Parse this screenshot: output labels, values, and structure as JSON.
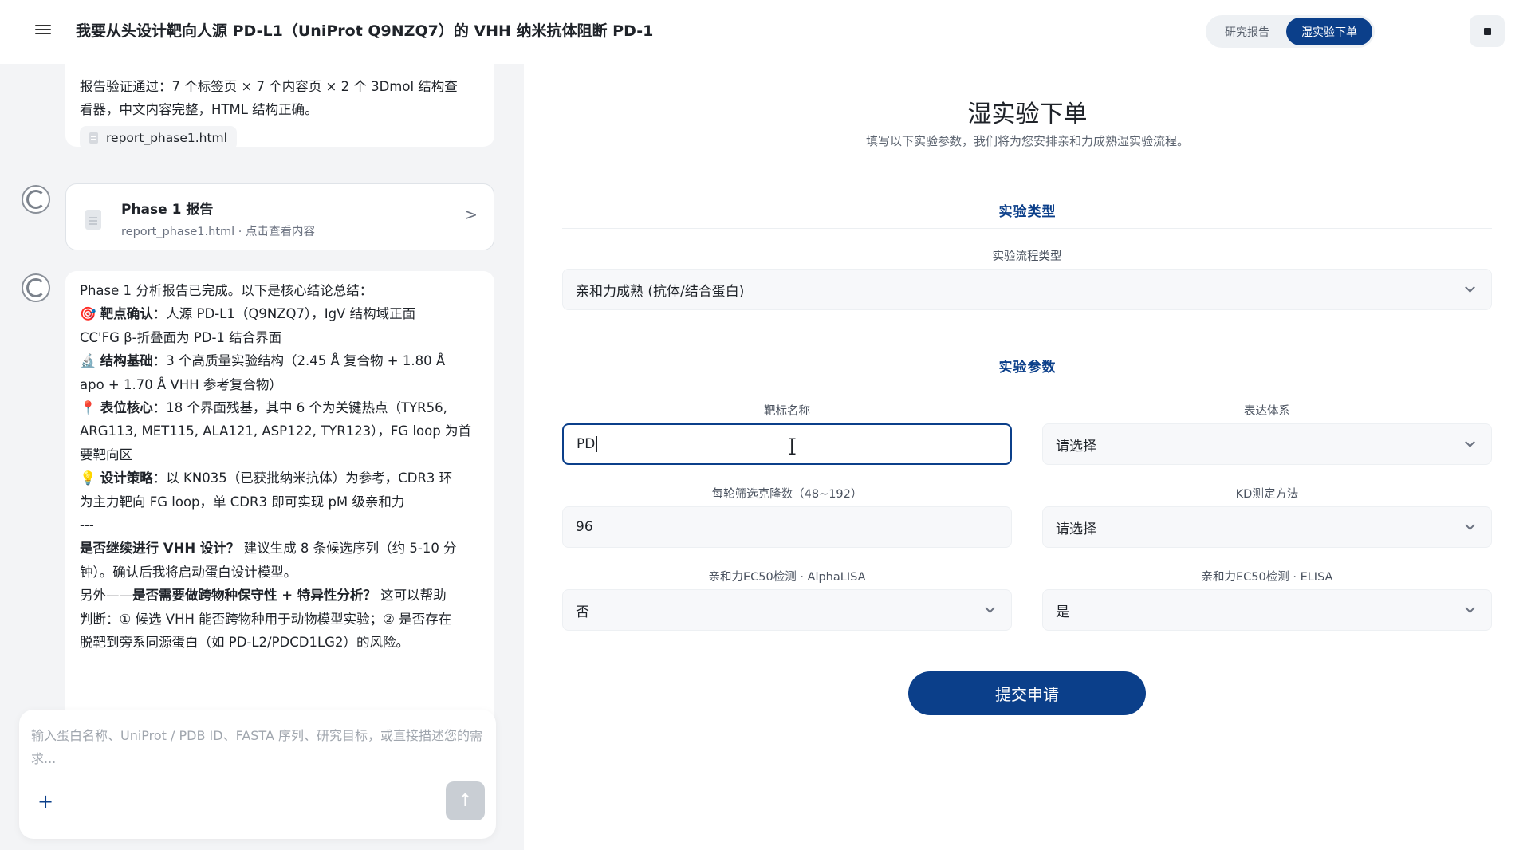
{
  "header": {
    "title": "我要从头设计靶向人源 PD-L1（UniProt Q9NZQ7）的 VHH 纳米抗体阻断 PD-1",
    "tabs": [
      {
        "label": "研究报告"
      },
      {
        "label": "湿实验下单"
      }
    ]
  },
  "chat": {
    "top_bubble": {
      "text": "报告验证通过：7 个标签页 × 7 个内容页 × 2 个 3Dmol 结构查看器，中文内容完整，HTML 结构正确。",
      "line1": "报告验证通过：7 个标签页 × 7 个内容页 × 2 个 3Dmol 结构查",
      "line2": "看器，中文内容完整，HTML 结构正确。",
      "file_name": "report_phase1.html"
    },
    "report_card": {
      "title": "Phase 1 报告",
      "subtitle": "report_phase1.html · 点击查看内容",
      "chevron": ">"
    },
    "summary": {
      "l1": "Phase 1 分析报告已完成。以下是核心结论总结：",
      "l2_emoji": "🎯",
      "l2_bold": "靶点确认",
      "l2_rest": "：人源 PD-L1（Q9NZQ7），IgV 结构域正面",
      "l3": "CC'FG β-折叠面为 PD-1 结合界面",
      "l4_emoji": "🔬",
      "l4_bold": "结构基础",
      "l4_rest": "：3 个高质量实验结构（2.45 Å 复合物 + 1.80 Å",
      "l5": "apo + 1.70 Å VHH 参考复合物）",
      "l6_emoji": "📍",
      "l6_bold": "表位核心",
      "l6_rest": "：18 个界面残基，其中 6 个为关键热点（TYR56,",
      "l7": "ARG113, MET115, ALA121, ASP122, TYR123），FG loop 为首",
      "l8": "要靶向区",
      "l9_emoji": "💡",
      "l9_bold": "设计策略",
      "l9_rest": "：以 KN035（已获批纳米抗体）为参考，CDR3 环",
      "l10": "为主力靶向 FG loop，单 CDR3 即可实现 pM 级亲和力",
      "l11": "---",
      "l12_bold": "是否继续进行 VHH 设计？",
      "l12_rest": " 建议生成 8 条候选序列（约 5-10 分",
      "l13": "钟）。确认后我将启动蛋白设计模型。",
      "l14_pre": "另外——",
      "l14_bold": "是否需要做跨物种保守性 + 特异性分析？",
      "l14_rest": " 这可以帮助",
      "l15": "判断：① 候选 VHH 能否跨物种用于动物模型实验；② 是否存在",
      "l16": "脱靶到旁系同源蛋白（如 PD-L2/PDCD1LG2）的风险。"
    },
    "input": {
      "placeholder": "输入蛋白名称、UniProt / PDB ID、FASTA 序列、研究目标，或直接描述您的需求...",
      "plus": "+",
      "send": "↑"
    }
  },
  "form": {
    "title": "湿实验下单",
    "subtitle": "填写以下实验参数，我们将为您安排亲和力成熟湿实验流程。",
    "section_type": "实验类型",
    "flow_type_label": "实验流程类型",
    "flow_type_value": "亲和力成熟 (抗体/结合蛋白)",
    "section_params": "实验参数",
    "target_name_label": "靶标名称",
    "target_name_value": "PD",
    "expression_label": "表达体系",
    "expression_value": "请选择",
    "clones_label": "每轮筛选克隆数（48~192）",
    "clones_value": "96",
    "kd_label": "KD测定方法",
    "kd_value": "请选择",
    "alphalisa_label": "亲和力EC50检测 · AlphaLISA",
    "alphalisa_value": "否",
    "elisa_label": "亲和力EC50检测 · ELISA",
    "elisa_value": "是",
    "submit_label": "提交申请"
  },
  "colors": {
    "brand": "#0b3f8a",
    "pane_bg": "#f3f4f6"
  }
}
